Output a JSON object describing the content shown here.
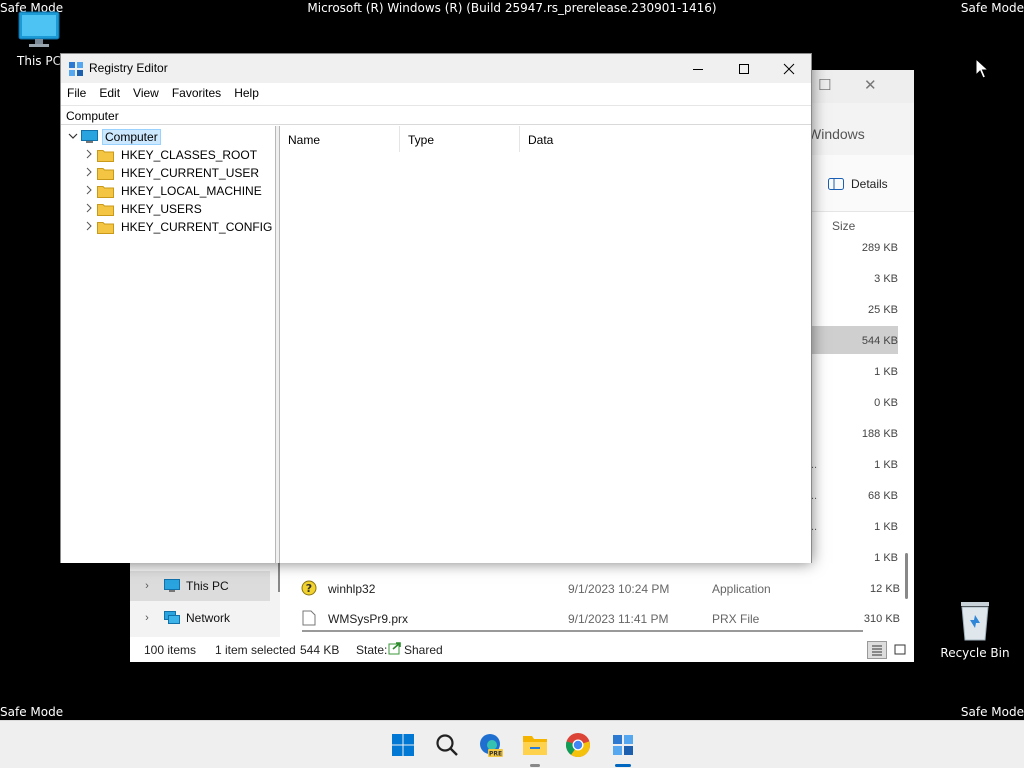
{
  "desktop": {
    "safe_mode_label": "Safe Mode",
    "build_text": "Microsoft (R) Windows (R) (Build 25947.rs_prerelease.230901-1416)",
    "icons": [
      {
        "label": "This PC",
        "icon": "monitor-icon"
      },
      {
        "label": "Recycle Bin",
        "icon": "recycle-bin-icon"
      }
    ]
  },
  "explorer": {
    "breadcrumb_fragment": "Windows",
    "details_label": "Details",
    "size_header": "Size",
    "sizes": [
      "289 KB",
      "3 KB",
      "25 KB",
      "544 KB",
      "1 KB",
      "0 KB",
      "188 KB",
      "1 KB",
      "68 KB",
      "1 KB",
      "1 KB"
    ],
    "selected_size_index": 3,
    "truncated_marker": "..",
    "sidebar": [
      {
        "label": "This PC",
        "icon": "monitor-icon",
        "selected": true
      },
      {
        "label": "Network",
        "icon": "network-icon",
        "selected": false
      }
    ],
    "files": [
      {
        "name": "winhlp32",
        "date": "9/1/2023 10:24 PM",
        "type": "Application",
        "size": "12 KB",
        "icon": "help-icon"
      },
      {
        "name": "WMSysPr9.prx",
        "date": "9/1/2023 11:41 PM",
        "type": "PRX File",
        "size": "310 KB",
        "icon": "file-icon"
      }
    ],
    "status": {
      "items": "100 items",
      "selected": "1 item selected",
      "size": "544 KB",
      "state_label": "State:",
      "state_value": "Shared"
    }
  },
  "regedit": {
    "title": "Registry Editor",
    "menu": [
      "File",
      "Edit",
      "View",
      "Favorites",
      "Help"
    ],
    "address": "Computer",
    "tree": {
      "root": "Computer",
      "keys": [
        "HKEY_CLASSES_ROOT",
        "HKEY_CURRENT_USER",
        "HKEY_LOCAL_MACHINE",
        "HKEY_USERS",
        "HKEY_CURRENT_CONFIG"
      ]
    },
    "columns": [
      "Name",
      "Type",
      "Data"
    ]
  },
  "taskbar": {
    "apps": [
      "start-icon",
      "search-icon",
      "edge-preview-icon",
      "file-explorer-icon",
      "chrome-icon",
      "registry-editor-icon"
    ],
    "edge_badge": "PRE"
  },
  "colors": {
    "accent": "#0067c0",
    "selection": "#cce8ff",
    "folder": "#f4c542",
    "taskbar_bg": "#efefef"
  }
}
